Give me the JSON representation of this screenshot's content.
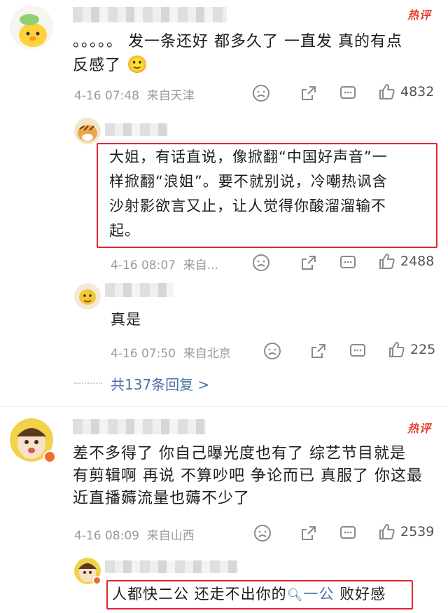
{
  "hot_label": "热评",
  "comments": [
    {
      "text_line1": "。。。。。 发一条还好 都多久了 一直发 真的有点",
      "text_line2": "反感了",
      "emoji": "🙂",
      "time": "4-16 07:48",
      "location": "来自天津",
      "likes": "4832"
    },
    {
      "text_line1": "差不多得了 你自己曝光度也有了 综艺节目就是",
      "text_line2": "有剪辑啊 再说 不算吵吧 争论而已 真服了 你这最",
      "text_line3": "近直播薅流量也薅不少了",
      "time": "4-16 08:09",
      "location": "来自山西",
      "likes": "2539"
    }
  ],
  "replies": [
    {
      "text_lines": [
        "大姐，有话直说，像掀翻“中国好声音”一",
        "样掀翻“浪姐”。要不就别说，冷嘲热讽含",
        "沙射影欲言又止，让人觉得你酸溜溜输不",
        "起。"
      ],
      "time": "4-16 08:07",
      "location": "来自...",
      "likes": "2488"
    },
    {
      "text": "真是",
      "time": "4-16 07:50",
      "location": "来自北京",
      "likes": "225"
    }
  ],
  "more_replies": "共137条回复 >",
  "last_reply": {
    "prefix": "人都快二公 还走不出你的",
    "link": "一公",
    "suffix": " 败好感"
  },
  "colors": {
    "accent_red": "#e3262f",
    "link_blue": "#4a72a8",
    "hot_red": "#e8412c"
  }
}
